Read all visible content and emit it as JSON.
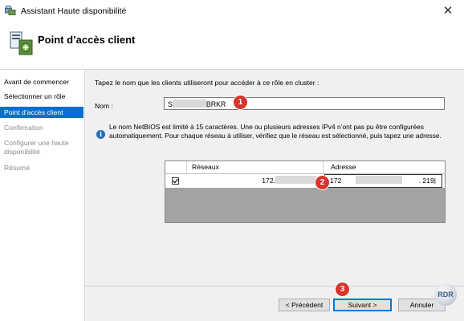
{
  "window": {
    "title": "Assistant Haute disponibilité",
    "close_glyph": "✕"
  },
  "header": {
    "title": "Point d’accès client"
  },
  "sidebar": {
    "items": [
      {
        "label": "Avant de commencer",
        "state": "done"
      },
      {
        "label": "Sélectionner un rôle",
        "state": "done"
      },
      {
        "label": "Point d’accès client",
        "state": "active"
      },
      {
        "label": "Confirmation",
        "state": "pending"
      },
      {
        "label": "Configurer une haute disponibilité",
        "state": "pending"
      },
      {
        "label": "Résumé",
        "state": "pending"
      }
    ]
  },
  "content": {
    "instruction": "Tapez le nom que les clients utiliseront pour accéder à ce rôle en cluster :",
    "name_label": "Nom :",
    "name_prefix": "S",
    "name_suffix": "BRKR",
    "info_icon": "i",
    "info_text": "Le nom NetBIOS est limité à 15 caractères.  Une ou plusieurs adresses IPv4 n’ont pas pu être configurées automatiquement. Pour chaque réseau à utiliser, vérifiez que le réseau est sélectionné, puis tapez une adresse.",
    "grid": {
      "col_networks": "Réseaux",
      "col_address": "Adresse",
      "row": {
        "checked": "☑",
        "network": "172.",
        "address_prefix": "172",
        "address_suffix": ".   219|"
      }
    }
  },
  "badges": [
    "1",
    "2",
    "3"
  ],
  "buttons": {
    "previous": "< Précédent",
    "next": "Suivant >",
    "cancel": "Annuler"
  },
  "logo_text": "RDR",
  "colors": {
    "accent": "#0a6ed1",
    "badge": "#d9342b",
    "grid_bg": "#a3a3a3"
  }
}
